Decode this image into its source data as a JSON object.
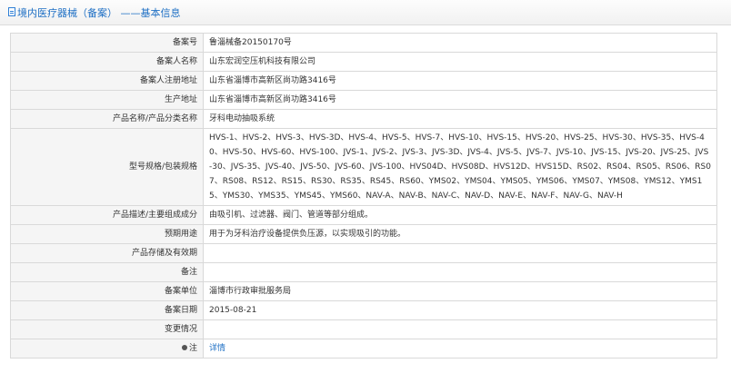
{
  "header": {
    "title": "境内医疗器械（备案） ——基本信息"
  },
  "rows": [
    {
      "label": "备案号",
      "value": "鲁淄械备20150170号"
    },
    {
      "label": "备案人名称",
      "value": "山东宏润空压机科技有限公司"
    },
    {
      "label": "备案人注册地址",
      "value": "山东省淄博市高新区尚功路3416号"
    },
    {
      "label": "生产地址",
      "value": "山东省淄博市高新区尚功路3416号"
    },
    {
      "label": "产品名称/产品分类名称",
      "value": "牙科电动抽吸系统"
    },
    {
      "label": "型号规格/包装规格",
      "value": "HVS-1、HVS-2、HVS-3、HVS-3D、HVS-4、HVS-5、HVS-7、HVS-10、HVS-15、HVS-20、HVS-25、HVS-30、HVS-35、HVS-40、HVS-50、HVS-60、HVS-100、JVS-1、JVS-2、JVS-3、JVS-3D、JVS-4、JVS-5、JVS-7、JVS-10、JVS-15、JVS-20、JVS-25、JVS-30、JVS-35、JVS-40、JVS-50、JVS-60、JVS-100、HVS04D、HVS08D、HVS12D、HVS15D、RS02、RS04、RS05、RS06、RS07、RS08、RS12、RS15、RS30、RS35、RS45、RS60、YMS02、YMS04、YMS05、YMS06、YMS07、YMS08、YMS12、YMS15、YMS30、YMS35、YMS45、YMS60、NAV-A、NAV-B、NAV-C、NAV-D、NAV-E、NAV-F、NAV-G、NAV-H"
    },
    {
      "label": "产品描述/主要组成成分",
      "value": "由吸引机、过滤器、阀门、管道等部分组成。"
    },
    {
      "label": "预期用途",
      "value": "用于为牙科治疗设备提供负压源，以实现吸引的功能。"
    },
    {
      "label": "产品存储及有效期",
      "value": ""
    },
    {
      "label": "备注",
      "value": ""
    },
    {
      "label": "备案单位",
      "value": "淄博市行政审批服务局"
    },
    {
      "label": "备案日期",
      "value": "2015-08-21"
    },
    {
      "label": "变更情况",
      "value": ""
    },
    {
      "label": "注",
      "value": "详情"
    }
  ]
}
